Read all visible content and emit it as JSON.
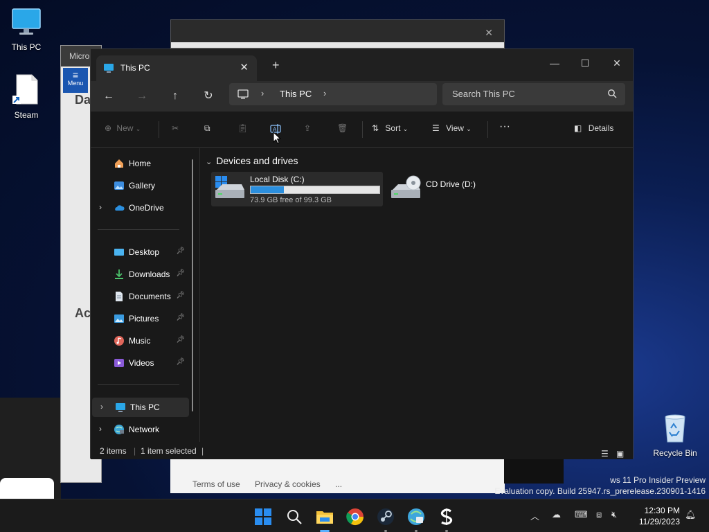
{
  "desktop": {
    "icons": [
      {
        "label": "This PC"
      },
      {
        "label": "Steam"
      },
      {
        "label": "Recycle Bin"
      }
    ],
    "watermark_line1": "ws 11 Pro Insider Preview",
    "watermark_line2": "Evaluation copy. Build 25947.rs_prerelease.230901-1416"
  },
  "background_windows": {
    "left_title": "Micro",
    "left_menu_label": "Menu",
    "left_text1": "Da",
    "left_text2": "Ac",
    "bottom_links": [
      "Terms of use",
      "Privacy & cookies",
      "..."
    ]
  },
  "explorer": {
    "tab_title": "This PC",
    "breadcrumb": "This PC",
    "search_placeholder": "Search This PC",
    "toolbar": {
      "new_label": "New",
      "sort_label": "Sort",
      "view_label": "View",
      "details_label": "Details"
    },
    "nav": [
      {
        "label": "Home",
        "icon": "home-icon"
      },
      {
        "label": "Gallery",
        "icon": "gallery-icon"
      },
      {
        "label": "OneDrive",
        "icon": "onedrive-icon"
      },
      {
        "label": "Desktop",
        "icon": "desktop-icon",
        "pinned": true
      },
      {
        "label": "Downloads",
        "icon": "downloads-icon",
        "pinned": true
      },
      {
        "label": "Documents",
        "icon": "documents-icon",
        "pinned": true
      },
      {
        "label": "Pictures",
        "icon": "pictures-icon",
        "pinned": true
      },
      {
        "label": "Music",
        "icon": "music-icon",
        "pinned": true
      },
      {
        "label": "Videos",
        "icon": "videos-icon",
        "pinned": true
      },
      {
        "label": "This PC",
        "icon": "this-pc-icon",
        "selected": true
      },
      {
        "label": "Network",
        "icon": "network-icon"
      }
    ],
    "group_header": "Devices and drives",
    "drives": [
      {
        "name": "Local Disk (C:)",
        "free_text": "73.9 GB free of 99.3 GB",
        "used_fraction": 0.256
      },
      {
        "name": "CD Drive (D:)"
      }
    ],
    "status": {
      "items": "2 items",
      "selected": "1 item selected"
    }
  },
  "taskbar": {
    "time": "12:30 PM",
    "date": "11/29/2023",
    "apps": [
      "start-icon",
      "search-icon",
      "file-explorer-icon",
      "chrome-icon",
      "steam-icon",
      "browser-icon",
      "app-s-icon"
    ]
  },
  "colors": {
    "accent": "#2b8fde",
    "window_bg": "#191919",
    "taskbar_bg": "#1b1b1b"
  }
}
